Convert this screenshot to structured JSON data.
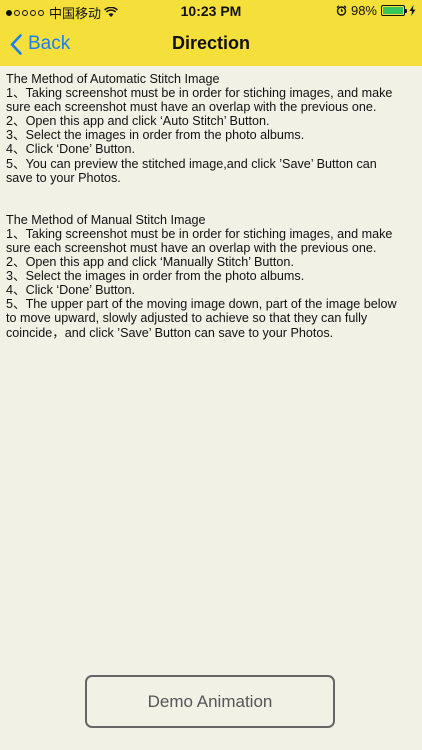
{
  "status_bar": {
    "carrier": "中国移动",
    "time": "10:23 PM",
    "battery_percent": "98%",
    "battery_level": 0.98,
    "signal_dots_filled": 1,
    "signal_dots_total": 5,
    "battery_color": "#35c759"
  },
  "nav": {
    "back_label": "Back",
    "title": "Direction",
    "bar_color": "#f5df3a",
    "accent_color": "#1a7ff5"
  },
  "content": {
    "automatic": {
      "title": "The Method of Automatic Stitch Image",
      "lines": [
        "1、Taking screenshot must be in order for stiching images, and make",
        "sure each screenshot must have an overlap with the previous one.",
        "2、Open this app and click ‘Auto Stitch’ Button.",
        "3、Select the images in order from the photo albums.",
        "4、Click ‘Done’ Button.",
        "5、You can preview the stitched image,and click ’Save’ Button can",
        "save to your Photos."
      ]
    },
    "manual": {
      "title": "The Method of Manual Stitch Image",
      "lines": [
        "1、Taking screenshot must be in order for stiching images, and make",
        "sure each screenshot must have an overlap with the previous one.",
        "2、Open this app and click ‘Manually Stitch’ Button.",
        "3、Select the images in order from the photo albums.",
        "4、Click ‘Done’ Button.",
        "5、The upper part of the moving image down, part of the image below",
        "to move upward, slowly adjusted to achieve so that they can fully",
        "coincide，and click ’Save’ Button can save to your Photos."
      ]
    }
  },
  "footer": {
    "demo_button_label": "Demo Animation"
  }
}
